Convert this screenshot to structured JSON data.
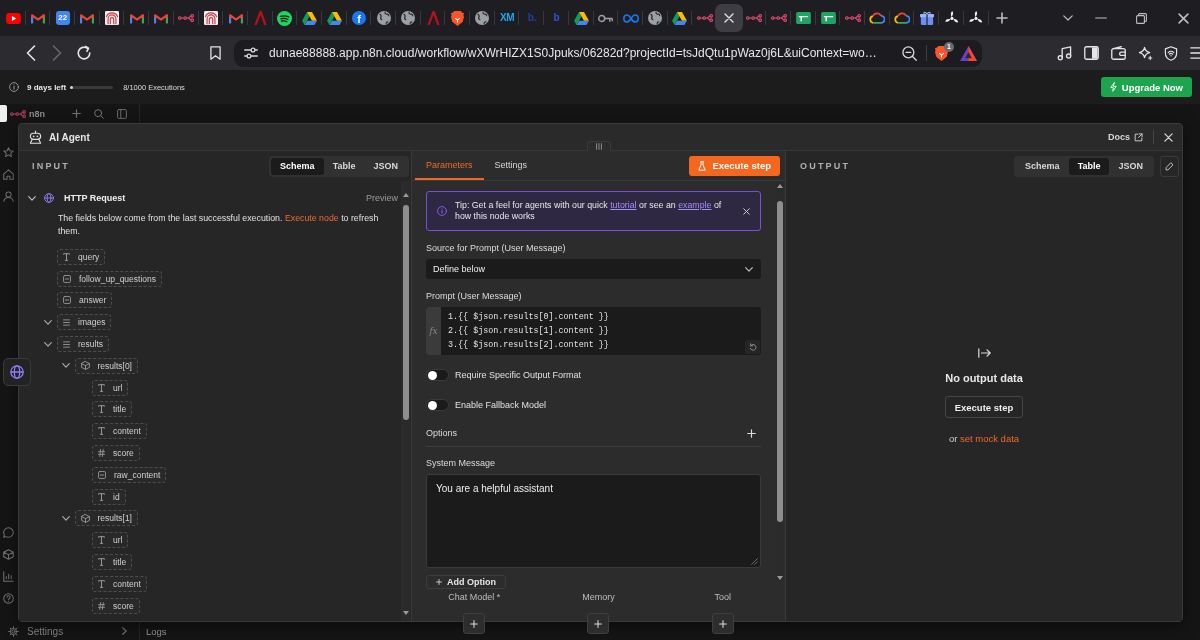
{
  "browser": {
    "tabs": [
      {
        "kind": "play",
        "selected": false
      },
      {
        "kind": "mail",
        "selected": false
      },
      {
        "kind": "calendar",
        "text": "22",
        "selected": false
      },
      {
        "kind": "mail",
        "selected": false
      },
      {
        "kind": "arches",
        "selected": false
      },
      {
        "kind": "mail",
        "selected": false
      },
      {
        "kind": "mail",
        "selected": false
      },
      {
        "kind": "nodes",
        "selected": false
      },
      {
        "kind": "arches",
        "selected": false
      },
      {
        "kind": "mail",
        "selected": false
      },
      {
        "kind": "peak",
        "selected": false
      },
      {
        "kind": "waves",
        "selected": false
      },
      {
        "kind": "triangle",
        "selected": false
      },
      {
        "kind": "triangle",
        "selected": false
      },
      {
        "kind": "letter",
        "text": "f",
        "color": "#1877f2",
        "selected": false
      },
      {
        "kind": "globe",
        "selected": false
      },
      {
        "kind": "globe",
        "selected": false
      },
      {
        "kind": "peak",
        "selected": false
      },
      {
        "kind": "lion",
        "selected": false
      },
      {
        "kind": "globe",
        "selected": false
      },
      {
        "kind": "text",
        "text": "XM",
        "color": "#1ea7e8",
        "selected": false
      },
      {
        "kind": "text",
        "text": "b.",
        "color": "#1e3fa6",
        "selected": false
      },
      {
        "kind": "text",
        "text": "b",
        "color": "#2b56d6",
        "selected": false
      },
      {
        "kind": "triangle",
        "selected": false
      },
      {
        "kind": "key",
        "selected": false
      },
      {
        "kind": "infinity",
        "selected": false
      },
      {
        "kind": "globe",
        "selected": false
      },
      {
        "kind": "triangle",
        "selected": false
      },
      {
        "kind": "nodes",
        "selected": false
      },
      {
        "kind": "close",
        "selected": true
      },
      {
        "kind": "nodes",
        "selected": false
      },
      {
        "kind": "nodes",
        "selected": false
      },
      {
        "kind": "sheet",
        "selected": false
      },
      {
        "kind": "sheet",
        "selected": false
      },
      {
        "kind": "nodes",
        "selected": false
      },
      {
        "kind": "cloud",
        "selected": false
      },
      {
        "kind": "cloud",
        "selected": false
      },
      {
        "kind": "gift",
        "selected": false
      },
      {
        "kind": "propeller",
        "selected": false
      },
      {
        "kind": "propeller",
        "selected": false
      }
    ],
    "nav_buttons": [
      {
        "kind": "back",
        "disabled": false
      },
      {
        "kind": "forward",
        "disabled": true
      },
      {
        "kind": "reload",
        "disabled": false
      }
    ],
    "url": "dunae88888.app.n8n.cloud/workflow/wXWrHIZX1S0Jpuks/06282d?projectId=tsJdQtu1pWaz0j6L&uiContext=wo…",
    "shields_count": "1"
  },
  "trial_bar": {
    "days_left": "9 days left",
    "level": 0.02,
    "executions": "8/1000 Executions",
    "upgrade_button": "Upgrade Now"
  },
  "app": {
    "logo": "n8n",
    "settings_label": "Settings",
    "logs_label": "Logs"
  },
  "node_view": {
    "title": "AI Agent",
    "docs_link": "Docs",
    "input": {
      "label": "INPUT",
      "view_tabs": [
        {
          "label": "Schema",
          "selected": true
        },
        {
          "label": "Table",
          "selected": false
        },
        {
          "label": "JSON",
          "selected": false
        }
      ],
      "node": {
        "name": "HTTP Request",
        "expanded": true,
        "preview": "Preview",
        "note": [
          {
            "kind": "text",
            "text": "The fields below come from the last successful execution."
          },
          {
            "kind": "link",
            "text": "Execute node"
          },
          {
            "kind": "text",
            "text": "to refresh them."
          }
        ],
        "fields": [
          {
            "name": "query",
            "kind": "string"
          },
          {
            "name": "follow_up_questions",
            "kind": "null"
          },
          {
            "name": "answer",
            "kind": "null"
          },
          {
            "name": "images",
            "kind": "array",
            "expanded": true
          },
          {
            "name": "results",
            "kind": "array",
            "expanded": true,
            "children": [
              {
                "name": "results[0]",
                "kind": "object",
                "expanded": true,
                "children": [
                  {
                    "name": "url",
                    "kind": "string"
                  },
                  {
                    "name": "title",
                    "kind": "string"
                  },
                  {
                    "name": "content",
                    "kind": "string"
                  },
                  {
                    "name": "score",
                    "kind": "number"
                  },
                  {
                    "name": "raw_content",
                    "kind": "null"
                  },
                  {
                    "name": "id",
                    "kind": "string"
                  }
                ]
              },
              {
                "name": "results[1]",
                "kind": "object",
                "expanded": true,
                "children": [
                  {
                    "name": "url",
                    "kind": "string"
                  },
                  {
                    "name": "title",
                    "kind": "string"
                  },
                  {
                    "name": "content",
                    "kind": "string"
                  },
                  {
                    "name": "score",
                    "kind": "number"
                  }
                ]
              }
            ]
          }
        ]
      }
    },
    "parameters": {
      "tabs": [
        {
          "label": "Parameters",
          "selected": true
        },
        {
          "label": "Settings",
          "selected": false
        }
      ],
      "execute_button": "Execute step",
      "tip": [
        {
          "kind": "text",
          "text": "Tip: Get a feel for agents with our quick"
        },
        {
          "kind": "link",
          "text": "tutorial"
        },
        {
          "kind": "text",
          "text": "or see an"
        },
        {
          "kind": "link",
          "text": "example"
        },
        {
          "kind": "text",
          "text": "of how this node works"
        }
      ],
      "source": {
        "label": "Source for Prompt (User Message)",
        "value": "Define below"
      },
      "prompt": {
        "label": "Prompt (User Message)",
        "badge": "fx",
        "lines": [
          "1.{{ $json.results[0].content }}",
          "2.{{ $json.results[1].content }}",
          "3.{{ $json.results[2].content }}"
        ]
      },
      "toggles": [
        {
          "label": "Require Specific Output Format",
          "on": false
        },
        {
          "label": "Enable Fallback Model",
          "on": false
        }
      ],
      "options_label": "Options",
      "system_message": {
        "label": "System Message",
        "value": "You are a helpful assistant"
      },
      "add_option_button": "Add Option",
      "connectors": [
        {
          "label": "Chat Model *"
        },
        {
          "label": "Memory"
        },
        {
          "label": "Tool"
        }
      ]
    },
    "output": {
      "label": "OUTPUT",
      "view_tabs": [
        {
          "label": "Schema",
          "selected": false
        },
        {
          "label": "Table",
          "selected": true
        },
        {
          "label": "JSON",
          "selected": false
        }
      ],
      "empty_title": "No output data",
      "execute_button": "Execute step",
      "hint": [
        {
          "kind": "text",
          "text": "or"
        },
        {
          "kind": "link",
          "text": "set mock data"
        }
      ]
    }
  }
}
